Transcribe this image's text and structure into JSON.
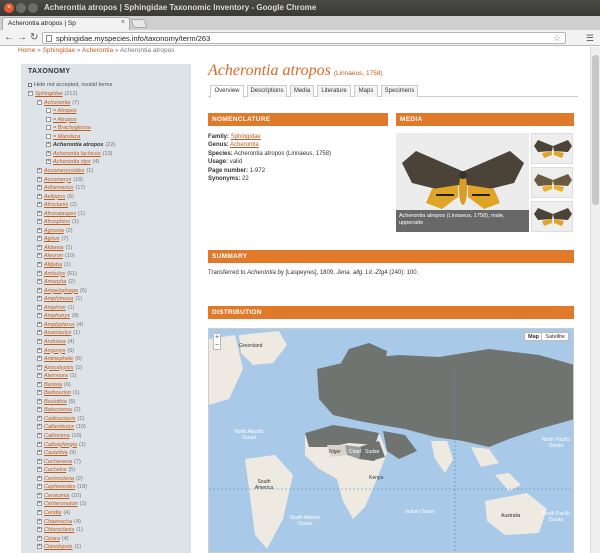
{
  "window": {
    "title": "Acherontia atropos | Sphingidae Taxonomic Inventory - Google Chrome",
    "close_glyph": "×"
  },
  "tab": {
    "label": "Acherontia atropos | Sp",
    "close_glyph": "×"
  },
  "address": {
    "url": "sphingidae.myspecies.info/taxonomy/term/263"
  },
  "breadcrumb": {
    "home": "Home",
    "sep": " » ",
    "family": "Sphingidae",
    "genus": "Acherontia",
    "current": "Acherontia atropos"
  },
  "sidebar": {
    "title": "TAXONOMY",
    "hide_label": "Hide not accepted, invalid terms",
    "tree": [
      {
        "name": "Sphingidae",
        "count": "(212)",
        "box": "−",
        "indent": 0
      },
      {
        "name": "Acherontia",
        "count": "(7)",
        "box": "−",
        "indent": 1
      },
      {
        "name": "= Atropos",
        "count": "",
        "box": "",
        "indent": 2
      },
      {
        "name": "= Atropos",
        "count": "",
        "box": "",
        "indent": 2
      },
      {
        "name": "= Brachyglossa",
        "count": "",
        "box": "",
        "indent": 2
      },
      {
        "name": "= Manduca",
        "count": "",
        "box": "",
        "indent": 2
      },
      {
        "name": "Acherontia atropos",
        "count": "(22)",
        "box": "+",
        "indent": 2,
        "current": true
      },
      {
        "name": "Acherontia lachesis",
        "count": "(13)",
        "box": "+",
        "indent": 2
      },
      {
        "name": "Acherontia styx",
        "count": "(4)",
        "box": "+",
        "indent": 2
      },
      {
        "name": "Acosmerycoides",
        "count": "(1)",
        "box": "+",
        "indent": 1
      },
      {
        "name": "Acosmeryx",
        "count": "(18)",
        "box": "+",
        "indent": 1
      },
      {
        "name": "Adhemarius",
        "count": "(17)",
        "box": "+",
        "indent": 1
      },
      {
        "name": "Aellopos",
        "count": "(6)",
        "box": "+",
        "indent": 1
      },
      {
        "name": "Afroclanis",
        "count": "(2)",
        "box": "+",
        "indent": 1
      },
      {
        "name": "Afrosataspes",
        "count": "(1)",
        "box": "+",
        "indent": 1
      },
      {
        "name": "Afrosphinx",
        "count": "(1)",
        "box": "+",
        "indent": 1
      },
      {
        "name": "Agnosia",
        "count": "(2)",
        "box": "+",
        "indent": 1
      },
      {
        "name": "Agrius",
        "count": "(7)",
        "box": "+",
        "indent": 1
      },
      {
        "name": "Akbesia",
        "count": "(1)",
        "box": "+",
        "indent": 1
      },
      {
        "name": "Aleuron",
        "count": "(10)",
        "box": "+",
        "indent": 1
      },
      {
        "name": "Altijuba",
        "count": "(1)",
        "box": "+",
        "indent": 1
      },
      {
        "name": "Ambulyx",
        "count": "(61)",
        "box": "+",
        "indent": 1
      },
      {
        "name": "Amorpha",
        "count": "(2)",
        "box": "+",
        "indent": 1
      },
      {
        "name": "Ampelophaga",
        "count": "(5)",
        "box": "+",
        "indent": 1
      },
      {
        "name": "Amphimoea",
        "count": "(1)",
        "box": "+",
        "indent": 1
      },
      {
        "name": "Amphion",
        "count": "(1)",
        "box": "+",
        "indent": 1
      },
      {
        "name": "Amphonyx",
        "count": "(8)",
        "box": "+",
        "indent": 1
      },
      {
        "name": "Amplypterus",
        "count": "(4)",
        "box": "+",
        "indent": 1
      },
      {
        "name": "Anambulyx",
        "count": "(1)",
        "box": "+",
        "indent": 1
      },
      {
        "name": "Andriasa",
        "count": "(4)",
        "box": "+",
        "indent": 1
      },
      {
        "name": "Angonyx",
        "count": "(6)",
        "box": "+",
        "indent": 1
      },
      {
        "name": "Antinephele",
        "count": "(8)",
        "box": "+",
        "indent": 1
      },
      {
        "name": "Apocalypsis",
        "count": "(1)",
        "box": "+",
        "indent": 1
      },
      {
        "name": "Atemnora",
        "count": "(1)",
        "box": "+",
        "indent": 1
      },
      {
        "name": "Banisia",
        "count": "(6)",
        "box": "+",
        "indent": 1
      },
      {
        "name": "Barbourion",
        "count": "(1)",
        "box": "+",
        "indent": 1
      },
      {
        "name": "Basiothia",
        "count": "(5)",
        "box": "+",
        "indent": 1
      },
      {
        "name": "Batocnema",
        "count": "(2)",
        "box": "+",
        "indent": 1
      },
      {
        "name": "Cadiouclanis",
        "count": "(1)",
        "box": "+",
        "indent": 1
      },
      {
        "name": "Callambulyx",
        "count": "(10)",
        "box": "+",
        "indent": 1
      },
      {
        "name": "Callionima",
        "count": "(10)",
        "box": "+",
        "indent": 1
      },
      {
        "name": "Callosphingia",
        "count": "(1)",
        "box": "+",
        "indent": 1
      },
      {
        "name": "Cautethia",
        "count": "(9)",
        "box": "+",
        "indent": 1
      },
      {
        "name": "Cechenena",
        "count": "(7)",
        "box": "+",
        "indent": 1
      },
      {
        "name": "Cechetra",
        "count": "(5)",
        "box": "+",
        "indent": 1
      },
      {
        "name": "Centroctena",
        "count": "(2)",
        "box": "+",
        "indent": 1
      },
      {
        "name": "Cephonodes",
        "count": "(18)",
        "box": "+",
        "indent": 1
      },
      {
        "name": "Ceratomia",
        "count": "(10)",
        "box": "+",
        "indent": 1
      },
      {
        "name": "Cerberonoton",
        "count": "(1)",
        "box": "+",
        "indent": 1
      },
      {
        "name": "Ceridia",
        "count": "(4)",
        "box": "+",
        "indent": 1
      },
      {
        "name": "Chaenocha",
        "count": "(4)",
        "box": "+",
        "indent": 1
      },
      {
        "name": "Chloroclanis",
        "count": "(1)",
        "box": "+",
        "indent": 1
      },
      {
        "name": "Cizara",
        "count": "(4)",
        "box": "+",
        "indent": 1
      },
      {
        "name": "Clanidopsis",
        "count": "(1)",
        "box": "+",
        "indent": 1
      },
      {
        "name": "Clanis",
        "count": "(21)",
        "box": "+",
        "indent": 1
      }
    ]
  },
  "main": {
    "title": "Acherontia atropos",
    "author": "(Linnaeus, 1758)",
    "tabs": [
      "Overview",
      "Descriptions",
      "Media",
      "Literature",
      "Maps",
      "Specimens"
    ],
    "nomenclature": {
      "heading": "NOMENCLATURE",
      "family_label": "Family:",
      "family_value": "Sphingidae",
      "genus_label": "Genus:",
      "genus_value": "Acherontia",
      "species_label": "Species:",
      "species_value": "Acherontia atropos (Linnaeus, 1758)",
      "usage_label": "Usage:",
      "usage_value": "valid",
      "page_label": "Page number:",
      "page_value": "1-972",
      "synonyms_label": "Synonyms:",
      "synonyms_value": "22"
    },
    "media": {
      "heading": "MEDIA",
      "caption": "Acherontia atropos (Linnaeus, 1758), male, upperside"
    },
    "summary": {
      "heading": "SUMMARY",
      "text_prefix": "Transferred to ",
      "text_genus": "Acherontia",
      "text_mid": " by [Laspeyres], 1809, ",
      "text_pub": "Jena. allg. Lit.-Ztg",
      "text_suffix": "4 (240): 100."
    },
    "distribution": {
      "heading": "DISTRIBUTION",
      "map_types": [
        "Map",
        "Satellite"
      ],
      "zoom_in": "+",
      "zoom_out": "−",
      "labels": {
        "greenland": "Greenland",
        "north_atlantic": "North Atlantic Ocean",
        "south_atlantic": "South Atlantic Ocean",
        "indian": "Indian Ocean",
        "south_pacific": "South Pacific Ocean",
        "north_pacific": "North Pacific Ocean",
        "south_america": "South America",
        "niger": "Niger",
        "chad": "Chad",
        "sudan": "Sudan",
        "kenya": "Kenya",
        "australia": "Australia"
      }
    }
  },
  "colors": {
    "accent": "#e07a2a",
    "link": "#c55b1a",
    "sidebar_bg": "#dde3e6",
    "ocean": "#a9c9e9",
    "land_inrange": "#6f7470",
    "land_other": "#eeeae2"
  },
  "icons": [
    "close-icon",
    "back-icon",
    "forward-icon",
    "reload-icon",
    "page-icon",
    "star-icon",
    "menu-icon"
  ]
}
